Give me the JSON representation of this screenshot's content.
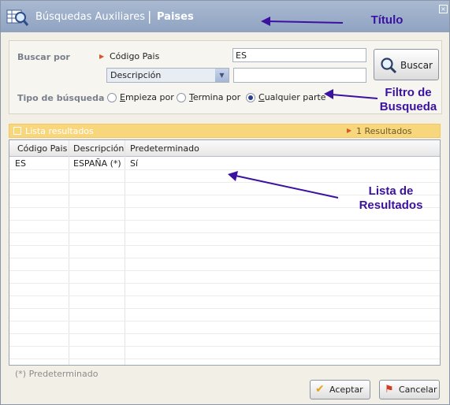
{
  "window": {
    "title_main": "Búsquedas Auxiliares",
    "title_separator": "|",
    "title_sub": "Paises",
    "close_label": "×"
  },
  "annotations": {
    "title_label": "Título",
    "filter_label_line1": "Filtro de",
    "filter_label_line2": "Busqueda",
    "results_label_line1": "Lista de",
    "results_label_line2": "Resultados",
    "arrow_color": "#3b12a0"
  },
  "filter": {
    "search_by_label": "Buscar por",
    "field_label": "Código Pais",
    "field_value": "ES",
    "select_value": "Descripción",
    "select_input_value": "",
    "search_button_label": "Buscar",
    "search_type_label": "Tipo de búsqueda",
    "options": [
      {
        "label": "Empieza por",
        "selected": false
      },
      {
        "label": "Termina por",
        "selected": false
      },
      {
        "label": "Cualquier parte",
        "selected": true
      }
    ]
  },
  "results": {
    "bar_label": "Lista resultados",
    "count_label": "1 Resultados",
    "columns": [
      "Código Pais",
      "Descripción",
      "Predeterminado"
    ],
    "rows": [
      [
        "ES",
        "ESPAÑA (*)",
        "Sí"
      ]
    ]
  },
  "footer": {
    "legend": "(*) Predeterminado",
    "accept_label": "Aceptar",
    "cancel_label": "Cancelar"
  },
  "colors": {
    "titlebar": "#9fb0cb",
    "results_bar": "#f8d77c",
    "annotation": "#3b12a0"
  }
}
